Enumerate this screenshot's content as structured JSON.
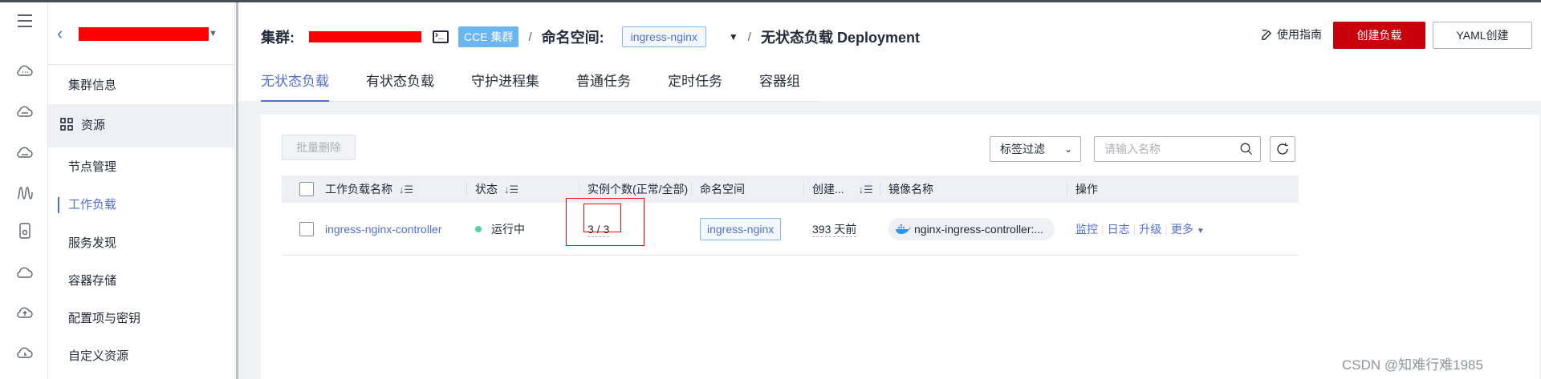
{
  "header": {
    "cluster_label": "集群:",
    "cluster_tag": "CCE 集群",
    "separator": "/",
    "namespace_label": "命名空间:",
    "namespace_value": "ingress-nginx",
    "page_title": "无状态负载 Deployment",
    "guide_label": "使用指南",
    "create_button": "创建负载",
    "yaml_button": "YAML创建"
  },
  "sidebar": {
    "items": [
      {
        "label": "集群信息"
      },
      {
        "label": "资源"
      },
      {
        "label": "节点管理"
      },
      {
        "label": "工作负载"
      },
      {
        "label": "服务发现"
      },
      {
        "label": "容器存储"
      },
      {
        "label": "配置项与密钥"
      },
      {
        "label": "自定义资源"
      }
    ]
  },
  "rail": {
    "icons": [
      "menu-icon",
      "cloud-icon",
      "cloud-server-icon",
      "cloud-db-icon",
      "waveform-icon",
      "device-icon",
      "cloud-outline-icon",
      "cloud-upload-icon",
      "cloud-time-icon"
    ]
  },
  "tabs": [
    {
      "label": "无状态负载",
      "active": true
    },
    {
      "label": "有状态负载"
    },
    {
      "label": "守护进程集"
    },
    {
      "label": "普通任务"
    },
    {
      "label": "定时任务"
    },
    {
      "label": "容器组"
    }
  ],
  "toolbar": {
    "batch_delete": "批量删除",
    "tag_filter": "标签过滤",
    "search_placeholder": "请输入名称"
  },
  "table": {
    "columns": [
      "工作负载名称",
      "状态",
      "实例个数(正常/全部)",
      "命名空间",
      "创建...",
      "镜像名称",
      "操作"
    ],
    "rows": [
      {
        "name": "ingress-nginx-controller",
        "status": "运行中",
        "instances": "3 / 3",
        "namespace": "ingress-nginx",
        "created": "393 天前",
        "image": "nginx-ingress-controller:...",
        "actions": [
          "监控",
          "日志",
          "升级",
          "更多"
        ]
      }
    ]
  },
  "watermark": "CSDN @知难行难1985",
  "colors": {
    "accent": "#526ecc",
    "primary_button": "#c7000b",
    "running": "#50d4ab",
    "annotation": "#ff0000"
  }
}
